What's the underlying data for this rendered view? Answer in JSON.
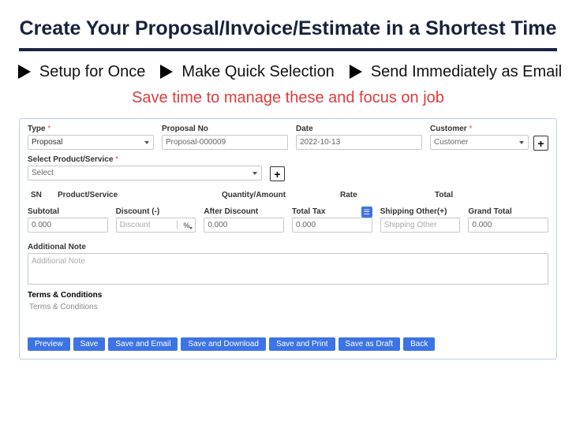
{
  "title": "Create Your Proposal/Invoice/Estimate in a Shortest Time",
  "features": [
    "Setup for Once",
    "Make Quick Selection",
    "Send Immediately as Email"
  ],
  "tagline": "Save time to manage these and focus on job",
  "form": {
    "type": {
      "label": "Type",
      "value": "Proposal"
    },
    "proposal_no": {
      "label": "Proposal No",
      "value": "Proposal-000009"
    },
    "date": {
      "label": "Date",
      "value": "2022-10-13"
    },
    "customer": {
      "label": "Customer",
      "value": "Customer"
    },
    "product": {
      "label": "Select Product/Service",
      "value": "Select"
    },
    "plus": "+",
    "thead": {
      "sn": "SN",
      "ps": "Product/Service",
      "qa": "Quantity/Amount",
      "rt": "Rate",
      "tt": "Total"
    },
    "subtotal": {
      "label": "Subtotal",
      "value": "0.000"
    },
    "discount": {
      "label": "Discount (-)",
      "placeholder": "Discount",
      "unit": "%"
    },
    "after_discount": {
      "label": "After Discount",
      "value": "0.000"
    },
    "total_tax": {
      "label": "Total Tax",
      "value": "0.000",
      "badge": "☰"
    },
    "shipping": {
      "label": "Shipping Other(+)",
      "placeholder": "Shipping Other"
    },
    "grand_total": {
      "label": "Grand Total",
      "value": "0.000"
    },
    "add_note": {
      "label": "Additional Note",
      "placeholder": "Additional Note"
    },
    "terms": {
      "label": "Terms & Conditions",
      "content": "Terms & Conditions"
    }
  },
  "buttons": [
    "Preview",
    "Save",
    "Save and Email",
    "Save and Download",
    "Save and Print",
    "Save as Draft",
    "Back"
  ]
}
